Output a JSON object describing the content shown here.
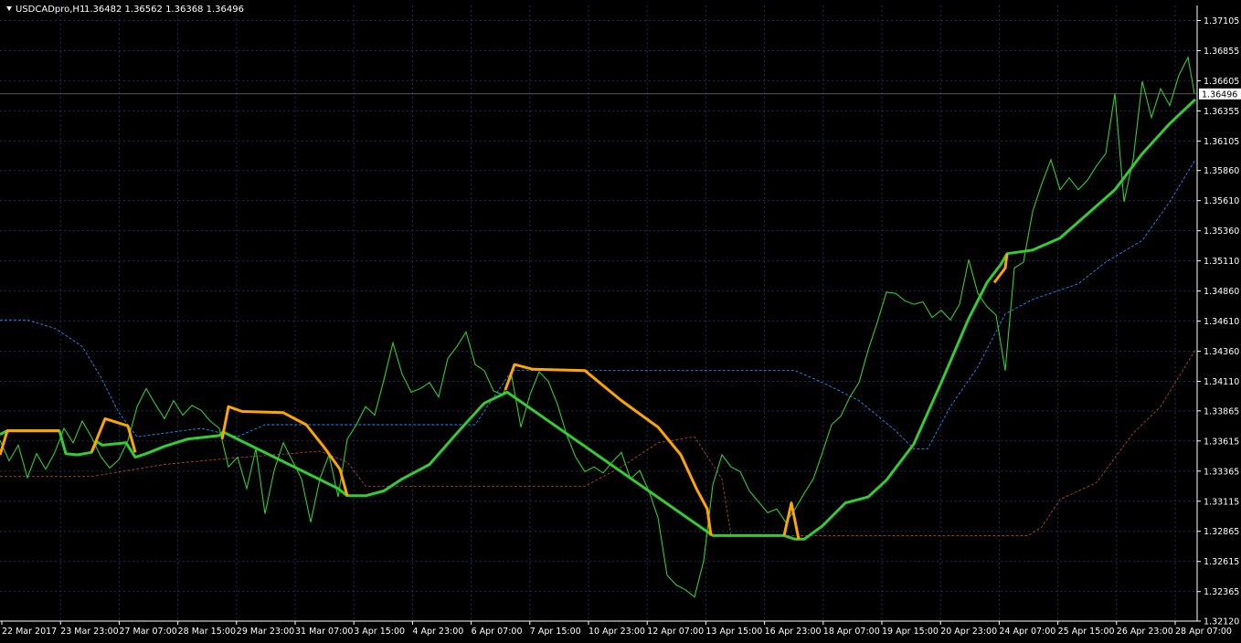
{
  "header": {
    "symbol": "USDCADpro,H1",
    "ohlc": "1.36482 1.36562 1.36368 1.36496"
  },
  "colors": {
    "background": "#000000",
    "grid": "#1f2a55",
    "price_line": "#33cc33",
    "trend_up": "#33cc33",
    "trend_down": "#ffa500",
    "upper_band": "#1e90ff",
    "lower_band": "#b04040",
    "axis": "#ffffff"
  },
  "chart_data": {
    "type": "line",
    "title": "USDCADpro,H1",
    "ylim": [
      1.3212,
      1.3723
    ],
    "current_price": "1.36496",
    "y_ticks": [
      "1.37105",
      "1.36855",
      "1.36605",
      "1.36355",
      "1.36105",
      "1.35860",
      "1.35610",
      "1.35360",
      "1.35110",
      "1.34860",
      "1.34610",
      "1.34360",
      "1.34110",
      "1.33865",
      "1.33615",
      "1.33365",
      "1.33115",
      "1.32865",
      "1.32615",
      "1.32365",
      "1.32120"
    ],
    "x_ticks": [
      "22 Mar 2017",
      "23 Mar 23:00",
      "27 Mar 07:00",
      "28 Mar 15:00",
      "29 Mar 23:00",
      "31 Mar 07:00",
      "3 Apr 15:00",
      "4 Apr 23:00",
      "6 Apr 07:00",
      "7 Apr 15:00",
      "10 Apr 23:00",
      "12 Apr 07:00",
      "13 Apr 15:00",
      "16 Apr 23:00",
      "18 Apr 07:00",
      "19 Apr 15:00",
      "20 Apr 23:00",
      "24 Apr 07:00",
      "25 Apr 15:00",
      "26 Apr 23:00",
      "28 Apr 07:00"
    ],
    "grid": true,
    "series": [
      {
        "key": "price",
        "style": "solid",
        "values": [
          [
            0,
            1.3362
          ],
          [
            10,
            1.3345
          ],
          [
            20,
            1.3358
          ],
          [
            30,
            1.3331
          ],
          [
            40,
            1.3351
          ],
          [
            50,
            1.3338
          ],
          [
            60,
            1.3352
          ],
          [
            70,
            1.3372
          ],
          [
            80,
            1.336
          ],
          [
            90,
            1.3378
          ],
          [
            100,
            1.3365
          ],
          [
            110,
            1.3349
          ],
          [
            120,
            1.3339
          ],
          [
            130,
            1.3346
          ],
          [
            140,
            1.3362
          ],
          [
            150,
            1.339
          ],
          [
            160,
            1.3405
          ],
          [
            170,
            1.3392
          ],
          [
            180,
            1.338
          ],
          [
            190,
            1.3395
          ],
          [
            200,
            1.3383
          ],
          [
            210,
            1.3391
          ],
          [
            220,
            1.3387
          ],
          [
            230,
            1.3378
          ],
          [
            240,
            1.3372
          ],
          [
            250,
            1.334
          ],
          [
            260,
            1.3348
          ],
          [
            270,
            1.3322
          ],
          [
            280,
            1.3355
          ],
          [
            290,
            1.3301
          ],
          [
            300,
            1.3337
          ],
          [
            310,
            1.336
          ],
          [
            320,
            1.3345
          ],
          [
            330,
            1.333
          ],
          [
            340,
            1.3294
          ],
          [
            350,
            1.333
          ],
          [
            360,
            1.335
          ],
          [
            370,
            1.3315
          ],
          [
            380,
            1.3363
          ],
          [
            390,
            1.3375
          ],
          [
            400,
            1.339
          ],
          [
            410,
            1.3383
          ],
          [
            420,
            1.3412
          ],
          [
            430,
            1.3443
          ],
          [
            440,
            1.3417
          ],
          [
            450,
            1.3402
          ],
          [
            460,
            1.3405
          ],
          [
            470,
            1.341
          ],
          [
            480,
            1.3398
          ],
          [
            490,
            1.343
          ],
          [
            500,
            1.344
          ],
          [
            510,
            1.3452
          ],
          [
            520,
            1.3425
          ],
          [
            530,
            1.342
          ],
          [
            540,
            1.3403
          ],
          [
            550,
            1.34
          ],
          [
            560,
            1.3415
          ],
          [
            570,
            1.3373
          ],
          [
            580,
            1.34
          ],
          [
            590,
            1.3419
          ],
          [
            600,
            1.3411
          ],
          [
            610,
            1.3392
          ],
          [
            620,
            1.3367
          ],
          [
            630,
            1.3348
          ],
          [
            640,
            1.3336
          ],
          [
            650,
            1.334
          ],
          [
            660,
            1.3335
          ],
          [
            670,
            1.3344
          ],
          [
            680,
            1.3352
          ],
          [
            690,
            1.333
          ],
          [
            700,
            1.3337
          ],
          [
            710,
            1.332
          ],
          [
            720,
            1.3298
          ],
          [
            730,
            1.325
          ],
          [
            740,
            1.3242
          ],
          [
            750,
            1.3238
          ],
          [
            760,
            1.3232
          ],
          [
            770,
            1.3262
          ],
          [
            780,
            1.3325
          ],
          [
            790,
            1.335
          ],
          [
            800,
            1.334
          ],
          [
            810,
            1.3336
          ],
          [
            820,
            1.332
          ],
          [
            830,
            1.3311
          ],
          [
            840,
            1.3302
          ],
          [
            850,
            1.3305
          ],
          [
            860,
            1.3294
          ],
          [
            870,
            1.3305
          ],
          [
            880,
            1.3318
          ],
          [
            890,
            1.333
          ],
          [
            900,
            1.3352
          ],
          [
            910,
            1.3375
          ],
          [
            920,
            1.3382
          ],
          [
            930,
            1.3398
          ],
          [
            940,
            1.341
          ],
          [
            950,
            1.3437
          ],
          [
            960,
            1.346
          ],
          [
            970,
            1.3485
          ],
          [
            980,
            1.3484
          ],
          [
            990,
            1.3478
          ],
          [
            1000,
            1.3475
          ],
          [
            1010,
            1.3477
          ],
          [
            1020,
            1.3464
          ],
          [
            1030,
            1.347
          ],
          [
            1040,
            1.3462
          ],
          [
            1050,
            1.3475
          ],
          [
            1060,
            1.3512
          ],
          [
            1070,
            1.3484
          ],
          [
            1080,
            1.3473
          ],
          [
            1090,
            1.3466
          ],
          [
            1100,
            1.342
          ],
          [
            1110,
            1.3505
          ],
          [
            1120,
            1.351
          ],
          [
            1130,
            1.3552
          ],
          [
            1140,
            1.3575
          ],
          [
            1150,
            1.3595
          ],
          [
            1160,
            1.357
          ],
          [
            1170,
            1.358
          ],
          [
            1180,
            1.357
          ],
          [
            1190,
            1.3578
          ],
          [
            1200,
            1.359
          ],
          [
            1210,
            1.36
          ],
          [
            1220,
            1.365
          ],
          [
            1230,
            1.356
          ],
          [
            1240,
            1.3595
          ],
          [
            1250,
            1.366
          ],
          [
            1260,
            1.363
          ],
          [
            1270,
            1.3654
          ],
          [
            1280,
            1.364
          ],
          [
            1290,
            1.3665
          ],
          [
            1300,
            1.368
          ],
          [
            1307,
            1.365
          ]
        ]
      },
      {
        "key": "trend_up",
        "style": "thick",
        "values": [
          [
            0,
            1.3367
          ],
          [
            8,
            1.337
          ],
          [
            65,
            1.337
          ],
          [
            72,
            1.3351
          ],
          [
            85,
            1.335
          ],
          [
            100,
            1.3352
          ],
          [
            106,
            1.3361
          ],
          [
            112,
            1.3358
          ],
          [
            138,
            1.336
          ],
          [
            148,
            1.3348
          ],
          [
            160,
            1.3351
          ],
          [
            180,
            1.3357
          ],
          [
            205,
            1.3363
          ],
          [
            240,
            1.3366
          ],
          [
            244,
            1.3369
          ],
          [
            370,
            1.3322
          ],
          [
            380,
            1.3316
          ],
          [
            400,
            1.3316
          ],
          [
            420,
            1.332
          ],
          [
            440,
            1.333
          ],
          [
            470,
            1.3342
          ],
          [
            500,
            1.3368
          ],
          [
            530,
            1.3393
          ],
          [
            555,
            1.3402
          ],
          [
            780,
            1.3283
          ],
          [
            800,
            1.3283
          ],
          [
            858,
            1.3283
          ],
          [
            870,
            1.328
          ],
          [
            880,
            1.328
          ],
          [
            900,
            1.3291
          ],
          [
            925,
            1.331
          ],
          [
            950,
            1.3315
          ],
          [
            970,
            1.3329
          ],
          [
            1000,
            1.3359
          ],
          [
            1030,
            1.341
          ],
          [
            1060,
            1.3463
          ],
          [
            1080,
            1.3493
          ],
          [
            1095,
            1.3508
          ],
          [
            1102,
            1.3517
          ],
          [
            1130,
            1.352
          ],
          [
            1160,
            1.353
          ],
          [
            1190,
            1.355
          ],
          [
            1220,
            1.357
          ],
          [
            1250,
            1.36
          ],
          [
            1280,
            1.3625
          ],
          [
            1308,
            1.3645
          ]
        ]
      },
      {
        "key": "trend_down",
        "style": "thick",
        "values": [
          [
            [
              0,
              1.335
            ],
            [
              8,
              1.337
            ],
            [
              65,
              1.337
            ]
          ],
          [
            [
              100,
              1.3352
            ],
            [
              115,
              1.338
            ],
            [
              140,
              1.3374
            ],
            [
              148,
              1.3352
            ]
          ],
          [
            [
              243,
              1.3363
            ],
            [
              250,
              1.339
            ],
            [
              265,
              1.3386
            ],
            [
              310,
              1.3385
            ],
            [
              335,
              1.3375
            ],
            [
              355,
              1.3356
            ],
            [
              372,
              1.3338
            ],
            [
              380,
              1.3316
            ]
          ],
          [
            [
              553,
              1.3404
            ],
            [
              563,
              1.3425
            ],
            [
              583,
              1.3421
            ],
            [
              640,
              1.342
            ],
            [
              680,
              1.3395
            ],
            [
              720,
              1.3373
            ],
            [
              745,
              1.335
            ],
            [
              762,
              1.3322
            ],
            [
              774,
              1.3305
            ],
            [
              778,
              1.3283
            ]
          ],
          [
            [
              858,
              1.3283
            ],
            [
              866,
              1.331
            ],
            [
              874,
              1.328
            ]
          ],
          [
            [
              1088,
              1.3493
            ],
            [
              1100,
              1.3505
            ],
            [
              1102,
              1.3517
            ]
          ]
        ]
      },
      {
        "key": "upper_band",
        "style": "dashed",
        "values": [
          [
            0,
            1.3462
          ],
          [
            30,
            1.3462
          ],
          [
            60,
            1.3455
          ],
          [
            90,
            1.344
          ],
          [
            110,
            1.3415
          ],
          [
            130,
            1.3385
          ],
          [
            150,
            1.3365
          ],
          [
            180,
            1.3368
          ],
          [
            220,
            1.3372
          ],
          [
            260,
            1.3365
          ],
          [
            290,
            1.3375
          ],
          [
            520,
            1.3375
          ],
          [
            560,
            1.342
          ],
          [
            870,
            1.342
          ],
          [
            900,
            1.341
          ],
          [
            940,
            1.3395
          ],
          [
            980,
            1.337
          ],
          [
            1000,
            1.3355
          ],
          [
            1015,
            1.3355
          ],
          [
            1040,
            1.339
          ],
          [
            1070,
            1.3423
          ],
          [
            1100,
            1.3467
          ],
          [
            1130,
            1.3479
          ],
          [
            1180,
            1.3492
          ],
          [
            1210,
            1.351
          ],
          [
            1250,
            1.3528
          ],
          [
            1280,
            1.356
          ],
          [
            1308,
            1.3595
          ]
        ]
      },
      {
        "key": "lower_band",
        "style": "dashed",
        "values": [
          [
            0,
            1.3332
          ],
          [
            100,
            1.3332
          ],
          [
            180,
            1.3342
          ],
          [
            250,
            1.3347
          ],
          [
            300,
            1.335
          ],
          [
            350,
            1.3353
          ],
          [
            380,
            1.3344
          ],
          [
            400,
            1.3324
          ],
          [
            640,
            1.3324
          ],
          [
            680,
            1.334
          ],
          [
            720,
            1.336
          ],
          [
            760,
            1.3365
          ],
          [
            790,
            1.333
          ],
          [
            800,
            1.3283
          ],
          [
            1125,
            1.3283
          ],
          [
            1140,
            1.329
          ],
          [
            1160,
            1.3313
          ],
          [
            1200,
            1.3327
          ],
          [
            1240,
            1.3368
          ],
          [
            1270,
            1.339
          ],
          [
            1308,
            1.3437
          ]
        ]
      }
    ]
  }
}
